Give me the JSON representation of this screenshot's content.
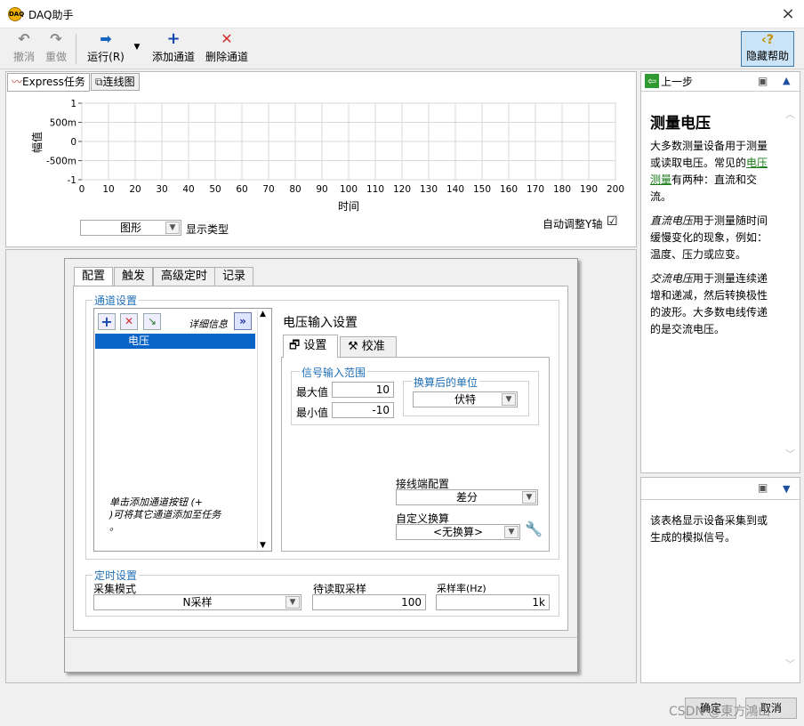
{
  "window": {
    "title": "DAQ助手",
    "close": "×"
  },
  "toolbar": {
    "undo": "撤消",
    "redo": "重做",
    "run": "运行(R)",
    "add_channel": "添加通道",
    "remove_channel": "删除通道",
    "hide_help": "隐藏帮助"
  },
  "view_tabs": {
    "express": "Express任务",
    "connection": "连线图"
  },
  "chart_data": {
    "type": "line",
    "xlabel": "时间",
    "ylabel": "幅值",
    "xlim": [
      0,
      200
    ],
    "ylim": [
      -1,
      1
    ],
    "x_ticks": [
      "0",
      "10",
      "20",
      "30",
      "40",
      "50",
      "60",
      "70",
      "80",
      "90",
      "100",
      "110",
      "120",
      "130",
      "140",
      "150",
      "160",
      "170",
      "180",
      "190",
      "200"
    ],
    "y_ticks": [
      "1",
      "500m",
      "0",
      "-500m",
      "-1"
    ],
    "series": [],
    "grid": true
  },
  "display": {
    "type_value": "图形",
    "type_label": "显示类型",
    "autoscale_label": "自动调整Y轴",
    "autoscale_check": "☑"
  },
  "config_tabs": [
    "配置",
    "触发",
    "高级定时",
    "记录"
  ],
  "channel_settings": {
    "title": "通道设置",
    "details_label": "详细信息",
    "channels": [
      "电压"
    ],
    "hint": "单击添加通道按钮 (+\n)可将其它通道添加至任务\n。"
  },
  "voltage_settings": {
    "title": "电压输入设置",
    "tabs": [
      "设置",
      "校准"
    ],
    "signal_range_title": "信号输入范围",
    "max_label": "最大值",
    "max_value": "10",
    "min_label": "最小值",
    "min_value": "-10",
    "units_title": "换算后的单位",
    "units_value": "伏特",
    "terminal_label": "接线端配置",
    "terminal_value": "差分",
    "custom_scale_label": "自定义换算",
    "custom_scale_value": "<无换算>"
  },
  "timing": {
    "title": "定时设置",
    "mode_label": "采集模式",
    "mode_value": "N采样",
    "samples_label": "待读取采样",
    "samples_value": "100",
    "rate_label": "采样率(Hz)",
    "rate_value": "1k"
  },
  "help": {
    "back": "上一步",
    "heading": "测量电压",
    "p1_a": "大多数测量设备用于测量或读取电压。常见的",
    "p1_link": "电压测量",
    "p1_b": "有两种：直流和交流。",
    "p2_em": "直流电压",
    "p2_rest": "用于测量随时间缓慢变化的现象，例如：温度、压力或应变。",
    "p3_em": "交流电压",
    "p3_rest": "用于测量连续递增和递减，然后转换极性的波形。大多数电线传递的是交流电压。",
    "bottom": "该表格显示设备采集到或生成的模拟信号。"
  },
  "footer": {
    "ok": "确定",
    "cancel": "取消",
    "watermark": "CSDN @東方鴻山"
  }
}
